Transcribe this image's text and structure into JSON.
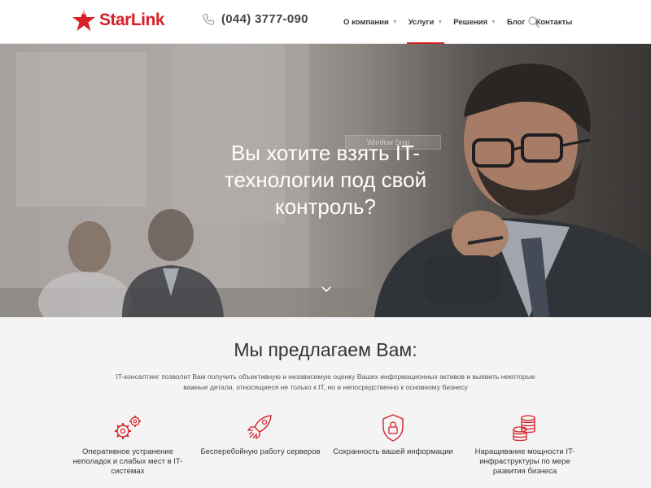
{
  "brand": {
    "name": "StarLink",
    "accent": "#d62128"
  },
  "header": {
    "phone": "(044) 3777-090",
    "nav": [
      {
        "label": "О компании",
        "has_submenu": true,
        "active": false
      },
      {
        "label": "Услуги",
        "has_submenu": true,
        "active": true
      },
      {
        "label": "Решения",
        "has_submenu": true,
        "active": false
      },
      {
        "label": "Блог",
        "has_submenu": false,
        "active": false
      },
      {
        "label": "Контакты",
        "has_submenu": false,
        "active": false
      }
    ],
    "search_icon": "search-icon"
  },
  "hero": {
    "title": "Вы хотите взять IT-технологии под свой контроль?",
    "overlay_tooltip": "Window Snip",
    "scroll_icon": "chevron-down-icon"
  },
  "offer": {
    "title": "Мы предлагаем Вам:",
    "description": "IT-консалтинг позволит Вам получить объективную и независимую оценку Ваших информационных активов и выявить некоторые важные детали, относящиеся не только к IT, но и непосредственно к основному бизнесу",
    "features": [
      {
        "icon": "gears-icon",
        "label": "Оперативное устранение неполадок и слабых мест в IT-системах"
      },
      {
        "icon": "rocket-icon",
        "label": "Бесперебойную работу серверов"
      },
      {
        "icon": "shield-lock-icon",
        "label": "Сохранность вашей информации"
      },
      {
        "icon": "coins-stack-icon",
        "label": "Наращивание мощности IT-инфраструктуры по мере развития бизнеса"
      }
    ]
  }
}
